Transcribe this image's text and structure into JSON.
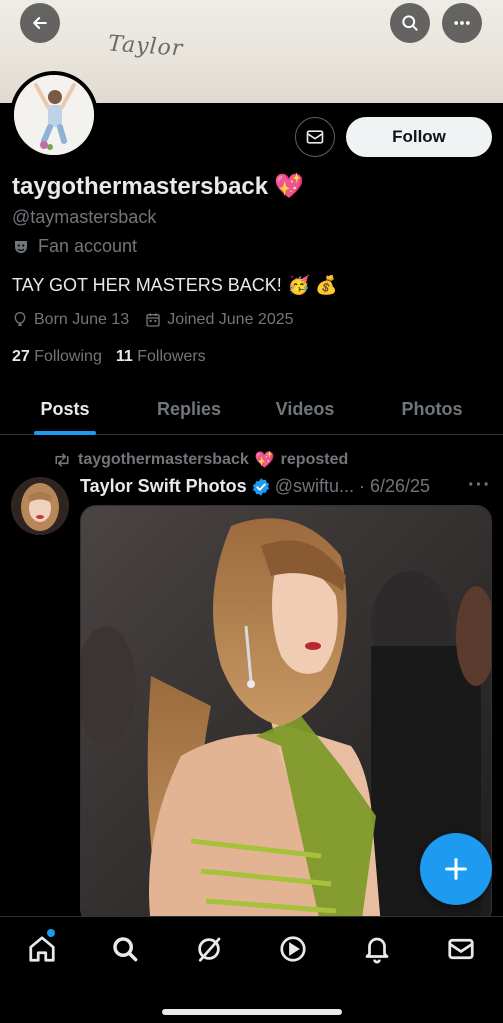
{
  "banner": {
    "text": "Taylor"
  },
  "header": {
    "back_icon": "arrow-left-icon",
    "search_icon": "search-icon",
    "more_icon": "more-horizontal-icon"
  },
  "profile": {
    "follow_label": "Follow",
    "display_name": "taygothermastersback",
    "name_emoji": "💖",
    "handle": "@taymastersback",
    "category": "Fan account",
    "bio": "TAY GOT HER MASTERS BACK!",
    "bio_emojis": "🥳 💰",
    "birthday": "Born June 13",
    "joined": "Joined June 2025",
    "following_count": "27",
    "following_label": "Following",
    "followers_count": "11",
    "followers_label": "Followers"
  },
  "tabs": [
    {
      "label": "Posts",
      "active": true
    },
    {
      "label": "Replies",
      "active": false
    },
    {
      "label": "Videos",
      "active": false
    },
    {
      "label": "Photos",
      "active": false
    }
  ],
  "post": {
    "repost_user": "taygothermastersback",
    "repost_emoji": "💖",
    "repost_suffix": "reposted",
    "author": "Taylor Swift Photos",
    "handle_date": "@swiftu... · 6/26/25",
    "more": "···"
  },
  "fab": {
    "icon": "plus-icon"
  },
  "bottom_nav": [
    "home-icon",
    "search-icon",
    "grok-icon",
    "video-icon",
    "bell-icon",
    "mail-icon"
  ],
  "colors": {
    "accent": "#1d9bf0",
    "verified": "#1d9bf0",
    "background": "#000000",
    "muted": "#71767b"
  }
}
